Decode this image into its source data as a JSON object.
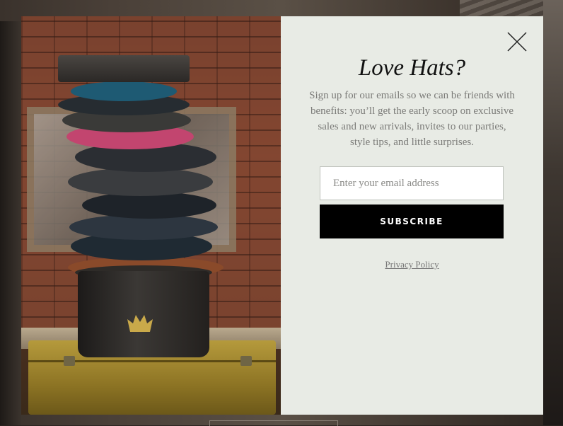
{
  "popup": {
    "title": "Love Hats?",
    "description": "Sign up for our emails so we can be friends with benefits: you’ll get the early scoop on exclusive sales and new arrivals, invites to our parties, style tips, and little surprises.",
    "email_placeholder": "Enter your email address",
    "subscribe_label": "SUBSCRIBE",
    "privacy_label": "Privacy Policy",
    "close_icon": "close-icon",
    "background_color": "#e8ebe5",
    "button_color": "#000000"
  },
  "image": {
    "subject": "stack-of-hats-on-hatbox",
    "logo_icon": "crown-icon"
  }
}
